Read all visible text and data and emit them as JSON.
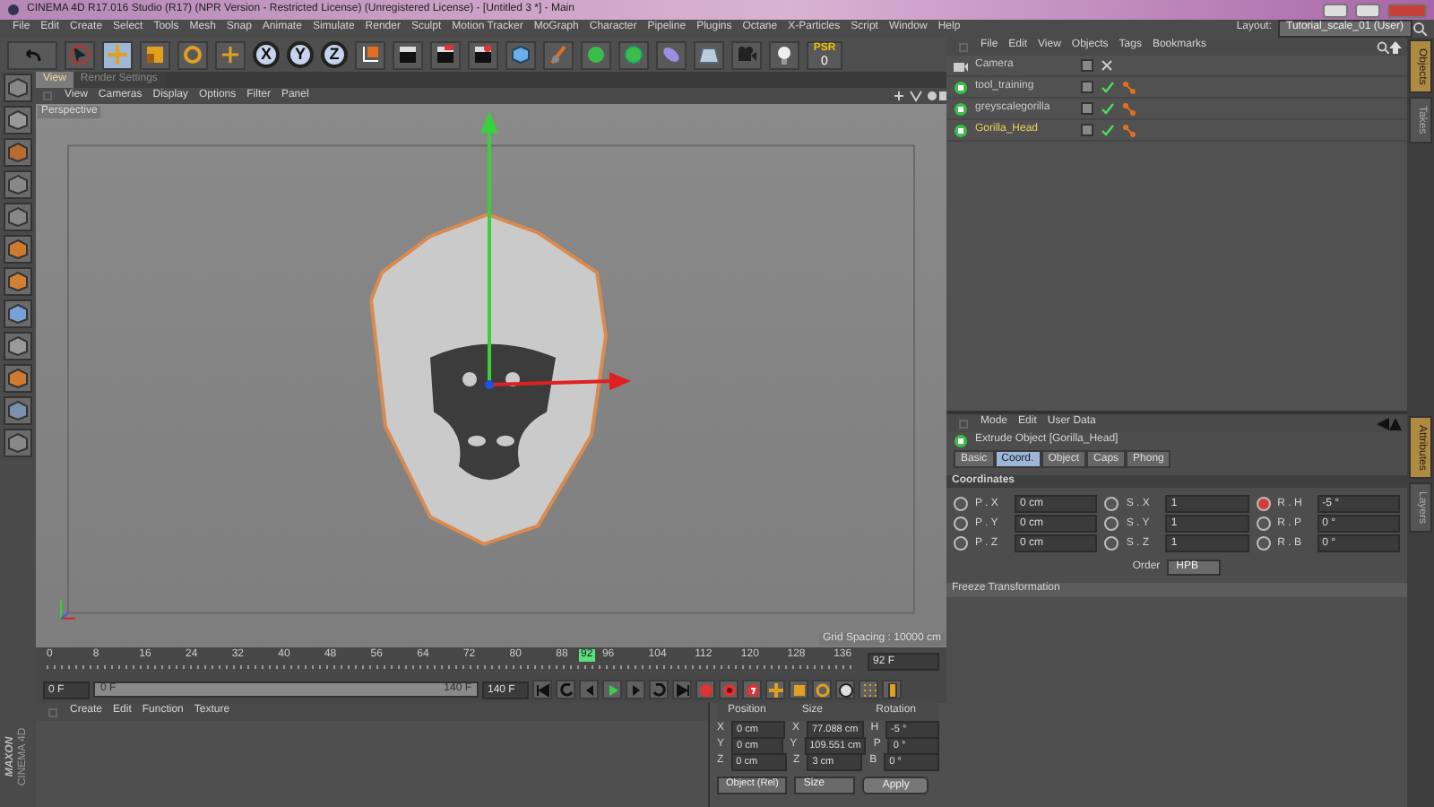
{
  "window": {
    "title": "CINEMA 4D R17.016 Studio (R17) (NPR Version - Restricted License) (Unregistered License) - [Untitled 3 *] - Main"
  },
  "menu": [
    "File",
    "Edit",
    "Create",
    "Select",
    "Tools",
    "Mesh",
    "Snap",
    "Animate",
    "Simulate",
    "Render",
    "Sculpt",
    "Motion Tracker",
    "MoGraph",
    "Character",
    "Pipeline",
    "Plugins",
    "Octane",
    "X-Particles",
    "Script",
    "Window",
    "Help"
  ],
  "layout": {
    "label": "Layout:",
    "value": "Tutorial_scale_01 (User)"
  },
  "toolbar": {
    "tools": [
      {
        "kind": "select",
        "selected": false
      },
      {
        "kind": "move",
        "selected": true
      },
      {
        "kind": "scale",
        "selected": false
      },
      {
        "kind": "rotate",
        "selected": false
      },
      {
        "kind": "recent",
        "selected": false
      }
    ],
    "axes": [
      {
        "label": "X",
        "on": true
      },
      {
        "label": "Y",
        "on": true
      },
      {
        "label": "Z",
        "on": true
      }
    ],
    "psr": {
      "label": "PSR",
      "value": "0"
    }
  },
  "viewport": {
    "tabs": [
      {
        "label": "View",
        "selected": true
      },
      {
        "label": "Render Settings",
        "selected": false
      }
    ],
    "menu": [
      "View",
      "Cameras",
      "Display",
      "Options",
      "Filter",
      "Panel"
    ],
    "camera": "Perspective",
    "grid_spacing": "Grid Spacing : 10000 cm"
  },
  "timeline": {
    "ticks": [
      "0",
      "8",
      "16",
      "24",
      "32",
      "40",
      "48",
      "56",
      "64",
      "72",
      "80",
      "88",
      "96",
      "104",
      "112",
      "120",
      "128",
      "136"
    ],
    "current": "92",
    "frame_field": "92 F",
    "start_field": "0 F",
    "range_slider": {
      "start": "0 F",
      "end": "140 F",
      "level": 1
    },
    "end_field": "140 F"
  },
  "material_manager": {
    "menu": [
      "Create",
      "Edit",
      "Function",
      "Texture"
    ]
  },
  "brand": {
    "name": "MAXON",
    "product": "CINEMA 4D"
  },
  "coordinates": {
    "headers": [
      "Position",
      "Size",
      "Rotation"
    ],
    "rows": [
      {
        "pos_axis": "X",
        "position": "0 cm",
        "size_axis": "X",
        "size": "77.088 cm",
        "rot_axis": "H",
        "rotation": "-5 °"
      },
      {
        "pos_axis": "Y",
        "position": "0 cm",
        "size_axis": "Y",
        "size": "109.551 cm",
        "rot_axis": "P",
        "rotation": "0 °"
      },
      {
        "pos_axis": "Z",
        "position": "0 cm",
        "size_axis": "Z",
        "size": "3 cm",
        "rot_axis": "B",
        "rotation": "0 °"
      }
    ],
    "mode": "Object (Rel)",
    "size_mode": "Size",
    "apply": "Apply"
  },
  "object_manager": {
    "menu": [
      "File",
      "Edit",
      "View",
      "Objects",
      "Tags",
      "Bookmarks"
    ],
    "objects": [
      {
        "name": "Camera",
        "kind": "camera",
        "selected": false
      },
      {
        "name": "tool_training",
        "kind": "extrude",
        "selected": false
      },
      {
        "name": "greyscalegorilla",
        "kind": "extrude",
        "selected": false
      },
      {
        "name": "Gorilla_Head",
        "kind": "extrude",
        "selected": true
      }
    ]
  },
  "attribute_manager": {
    "menu": [
      "Mode",
      "Edit",
      "User Data"
    ],
    "title": "Extrude Object [Gorilla_Head]",
    "tabs": [
      {
        "label": "Basic",
        "selected": false
      },
      {
        "label": "Coord.",
        "selected": true
      },
      {
        "label": "Object",
        "selected": false
      },
      {
        "label": "Caps",
        "selected": false
      },
      {
        "label": "Phong",
        "selected": false
      }
    ],
    "section": "Coordinates",
    "fields": [
      {
        "label": "P . X",
        "value": "0 cm",
        "keyed": false
      },
      {
        "label": "S . X",
        "value": "1",
        "keyed": false
      },
      {
        "label": "R . H",
        "value": "-5 °",
        "keyed": true
      },
      {
        "label": "P . Y",
        "value": "0 cm",
        "keyed": false
      },
      {
        "label": "S . Y",
        "value": "1",
        "keyed": false
      },
      {
        "label": "R . P",
        "value": "0 °",
        "keyed": false
      },
      {
        "label": "P . Z",
        "value": "0 cm",
        "keyed": false
      },
      {
        "label": "S . Z",
        "value": "1",
        "keyed": false
      },
      {
        "label": "R . B",
        "value": "0 °",
        "keyed": false
      }
    ],
    "order": {
      "label": "Order",
      "value": "HPB"
    },
    "freeze": "Freeze Transformation"
  },
  "side_tabs_top": [
    {
      "label": "Objects",
      "selected": true
    },
    {
      "label": "Takes",
      "selected": false
    }
  ],
  "side_tabs_bottom": [
    {
      "label": "Attributes",
      "selected": true
    },
    {
      "label": "Layers",
      "selected": false
    }
  ]
}
